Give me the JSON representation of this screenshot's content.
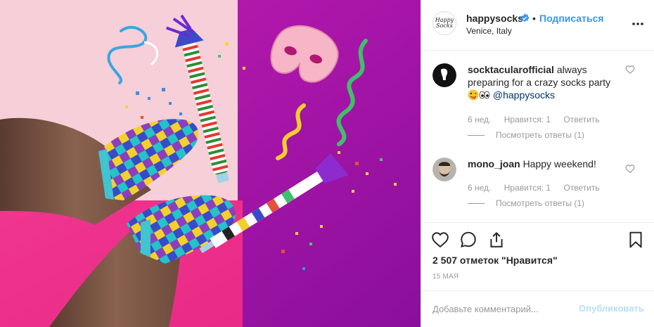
{
  "header": {
    "avatar_text": "Happy Socks",
    "username": "happysocks",
    "dot": "•",
    "follow_label": "Подписаться",
    "location": "Venice, Italy"
  },
  "comments": [
    {
      "username": "socktacularofficial",
      "text": "always preparing for a crazy socks party",
      "mention": "@happysocks",
      "age": "6 нед.",
      "likes": "Нравится: 1",
      "reply": "Ответить",
      "view_replies": "Посмотреть ответы (1)"
    },
    {
      "username": "mono_joan",
      "text": "Happy weekend!",
      "age": "6 нед.",
      "likes": "Нравится: 1",
      "reply": "Ответить",
      "view_replies": "Посмотреть ответы (1)"
    }
  ],
  "likes_label": "2 507 отметок \"Нравится\"",
  "date": "15 МАЯ",
  "add_comment": {
    "placeholder": "Добавьте комментарий...",
    "publish_label": "Опубликовать"
  },
  "colors": {
    "accent": "#3897f0",
    "publish_disabled": "#b2dffc",
    "mention": "#003569"
  },
  "icons": [
    "verified-badge-icon",
    "more-options-icon",
    "heart-icon",
    "comment-icon",
    "share-icon",
    "bookmark-icon"
  ]
}
